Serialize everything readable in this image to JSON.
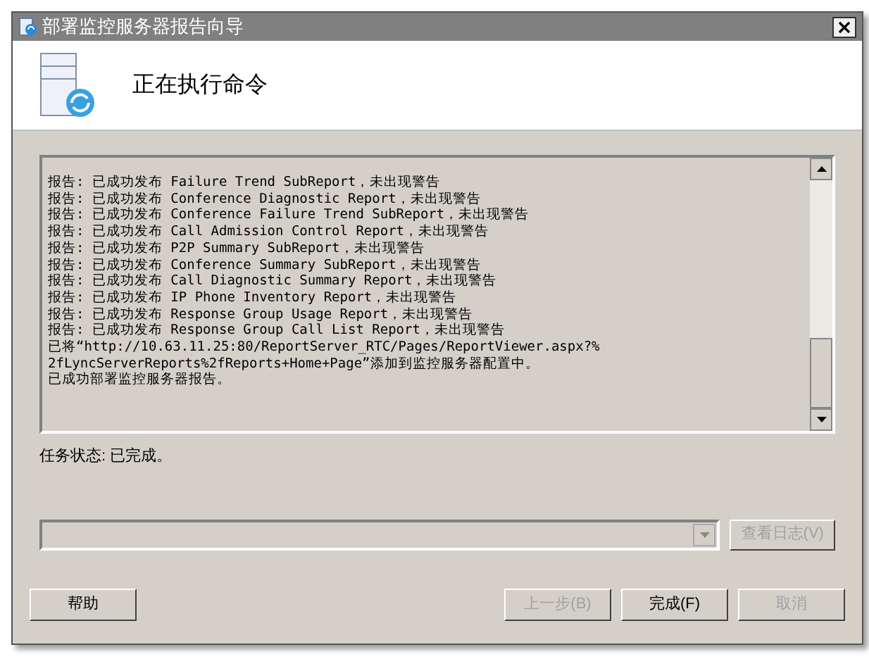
{
  "window": {
    "title": "部署监控服务器报告向导"
  },
  "header": {
    "title": "正在执行命令"
  },
  "log": {
    "lines": [
      "报告: 已成功发布 Failure Trend SubReport，未出现警告",
      "报告: 已成功发布 Conference Diagnostic Report，未出现警告",
      "报告: 已成功发布 Conference Failure Trend SubReport，未出现警告",
      "报告: 已成功发布 Call Admission Control Report，未出现警告",
      "报告: 已成功发布 P2P Summary SubReport，未出现警告",
      "报告: 已成功发布 Conference Summary SubReport，未出现警告",
      "报告: 已成功发布 Call Diagnostic Summary Report，未出现警告",
      "报告: 已成功发布 IP Phone Inventory Report，未出现警告",
      "报告: 已成功发布 Response Group Usage Report，未出现警告",
      "报告: 已成功发布 Response Group Call List Report，未出现警告",
      "已将“http://10.63.11.25:80/ReportServer_RTC/Pages/ReportViewer.aspx?%",
      "2fLyncServerReports%2fReports+Home+Page”添加到监控服务器配置中。",
      "已成功部署监控服务器报告。"
    ]
  },
  "task_status": "任务状态: 已完成。",
  "log_button": {
    "label": "查看日志(V)",
    "disabled": true
  },
  "buttons": [
    {
      "label": "帮助",
      "disabled": false
    },
    {
      "label": "上一步(B)",
      "disabled": true
    },
    {
      "label": "完成(F)",
      "disabled": false
    },
    {
      "label": "取消",
      "disabled": true
    }
  ]
}
